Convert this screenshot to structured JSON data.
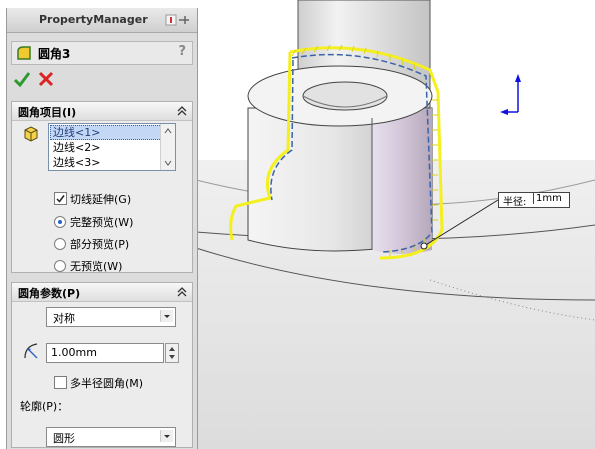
{
  "panel": {
    "title": "PropertyManager",
    "feature_name": "圆角3",
    "help": "?"
  },
  "fillet_items": {
    "title": "圆角项目(I)",
    "edges": [
      "边线<1>",
      "边线<2>",
      "边线<3>"
    ],
    "tangent_propagation": {
      "label": "切线延伸(G)",
      "checked": true
    },
    "preview_options": [
      {
        "label": "完整预览(W)",
        "selected": true
      },
      {
        "label": "部分预览(P)",
        "selected": false
      },
      {
        "label": "无预览(W)",
        "selected": false
      }
    ]
  },
  "fillet_params": {
    "title": "圆角参数(P)",
    "method": "对称",
    "radius": "1.00mm",
    "multi_radius": {
      "label": "多半径圆角(M)",
      "checked": false
    },
    "profile_label": "轮廓(P)：",
    "profile": "圆形"
  },
  "callout": {
    "label": "半径:",
    "value": "1mm"
  },
  "colors": {
    "selection_yellow": "#f4ef1f",
    "selection_blue": "#3a63a8",
    "triad_blue": "#1010e0"
  }
}
